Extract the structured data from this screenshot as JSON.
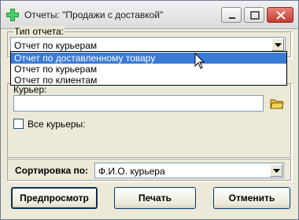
{
  "window": {
    "title": "Отчеты: \"Продажи с доставкой\""
  },
  "report_type": {
    "label": "Тип отчета:",
    "selected": "Отчет по курьерам",
    "options": [
      {
        "label": "Отчет по доставленному товару",
        "highlighted": true
      },
      {
        "label": "Отчет по курьерам",
        "highlighted": false
      },
      {
        "label": "Отчет по клиентам",
        "highlighted": false
      }
    ]
  },
  "courier": {
    "label": "Курьер:",
    "value": "",
    "all_couriers_label": "Все курьеры:",
    "all_couriers_checked": false
  },
  "sort": {
    "label": "Сортировка по:",
    "selected": "Ф.И.О. курьера"
  },
  "buttons": {
    "preview": "Предпросмотр",
    "print": "Печать",
    "cancel": "Отменить"
  },
  "colors": {
    "highlight": "#3a7bd5",
    "close_button": "#c43a2e"
  }
}
